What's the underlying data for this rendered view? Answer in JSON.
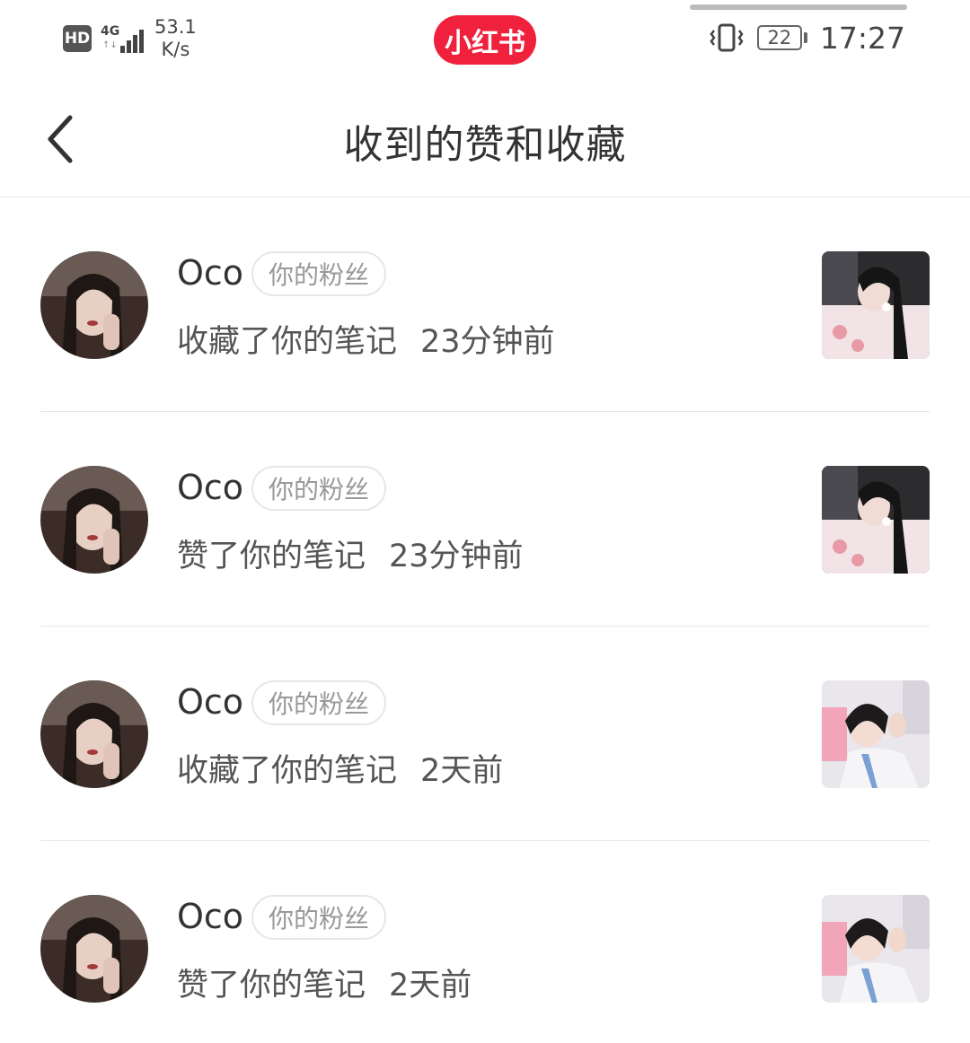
{
  "status_bar": {
    "hd": "HD",
    "network": "4G",
    "speed_value": "53.1",
    "speed_unit": "K/s",
    "app_badge": "小红书",
    "battery": "22",
    "time": "17:27"
  },
  "header": {
    "title": "收到的赞和收藏"
  },
  "notifications": [
    {
      "name": "Oco",
      "tag": "你的粉丝",
      "action": "收藏了你的笔记",
      "time": "23分钟前",
      "thumb_style": "a"
    },
    {
      "name": "Oco",
      "tag": "你的粉丝",
      "action": "赞了你的笔记",
      "time": "23分钟前",
      "thumb_style": "a"
    },
    {
      "name": "Oco",
      "tag": "你的粉丝",
      "action": "收藏了你的笔记",
      "time": "2天前",
      "thumb_style": "b"
    },
    {
      "name": "Oco",
      "tag": "你的粉丝",
      "action": "赞了你的笔记",
      "time": "2天前",
      "thumb_style": "b"
    }
  ],
  "colors": {
    "brand": "#f0213c",
    "text_primary": "#333333",
    "text_secondary": "#555555",
    "tag_text": "#999999",
    "divider": "#e6e6e6"
  }
}
